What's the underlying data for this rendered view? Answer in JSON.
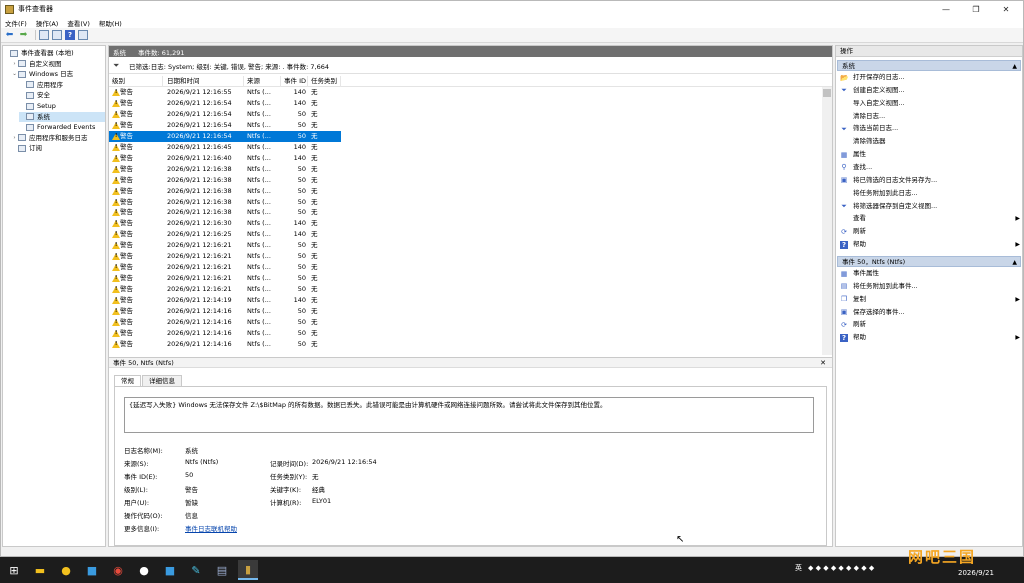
{
  "window": {
    "title": "事件查看器"
  },
  "menu": [
    "文件(F)",
    "操作(A)",
    "查看(V)",
    "帮助(H)"
  ],
  "tree": [
    {
      "label": "事件查看器 (本地)",
      "indent": 0,
      "arrow": ""
    },
    {
      "label": "自定义视图",
      "indent": 1,
      "arrow": "›"
    },
    {
      "label": "Windows 日志",
      "indent": 1,
      "arrow": "⌄"
    },
    {
      "label": "应用程序",
      "indent": 2,
      "arrow": ""
    },
    {
      "label": "安全",
      "indent": 2,
      "arrow": ""
    },
    {
      "label": "Setup",
      "indent": 2,
      "arrow": ""
    },
    {
      "label": "系统",
      "indent": 2,
      "arrow": "",
      "selected": true
    },
    {
      "label": "Forwarded Events",
      "indent": 2,
      "arrow": ""
    },
    {
      "label": "应用程序和服务日志",
      "indent": 1,
      "arrow": "›"
    },
    {
      "label": "订阅",
      "indent": 1,
      "arrow": ""
    }
  ],
  "center": {
    "log_name": "系统",
    "event_count": "事件数: 61,291",
    "filter_text": "已筛选:日志: System; 级别: 关键, 错误, 警告; 来源: . 事件数: 7,664",
    "columns": [
      "级别",
      "日期和时间",
      "来源",
      "事件 ID",
      "任务类别"
    ],
    "rows": [
      [
        "警告",
        "2026/9/21 12:16:55",
        "Ntfs (...",
        "140",
        "无"
      ],
      [
        "警告",
        "2026/9/21 12:16:54",
        "Ntfs (...",
        "140",
        "无"
      ],
      [
        "警告",
        "2026/9/21 12:16:54",
        "Ntfs (...",
        "50",
        "无"
      ],
      [
        "警告",
        "2026/9/21 12:16:54",
        "Ntfs (...",
        "50",
        "无"
      ],
      [
        "警告",
        "2026/9/21 12:16:54",
        "Ntfs (...",
        "50",
        "无"
      ],
      [
        "警告",
        "2026/9/21 12:16:45",
        "Ntfs (...",
        "140",
        "无"
      ],
      [
        "警告",
        "2026/9/21 12:16:40",
        "Ntfs (...",
        "140",
        "无"
      ],
      [
        "警告",
        "2026/9/21 12:16:38",
        "Ntfs (...",
        "50",
        "无"
      ],
      [
        "警告",
        "2026/9/21 12:16:38",
        "Ntfs (...",
        "50",
        "无"
      ],
      [
        "警告",
        "2026/9/21 12:16:38",
        "Ntfs (...",
        "50",
        "无"
      ],
      [
        "警告",
        "2026/9/21 12:16:38",
        "Ntfs (...",
        "50",
        "无"
      ],
      [
        "警告",
        "2026/9/21 12:16:38",
        "Ntfs (...",
        "50",
        "无"
      ],
      [
        "警告",
        "2026/9/21 12:16:30",
        "Ntfs (...",
        "140",
        "无"
      ],
      [
        "警告",
        "2026/9/21 12:16:25",
        "Ntfs (...",
        "140",
        "无"
      ],
      [
        "警告",
        "2026/9/21 12:16:21",
        "Ntfs (...",
        "50",
        "无"
      ],
      [
        "警告",
        "2026/9/21 12:16:21",
        "Ntfs (...",
        "50",
        "无"
      ],
      [
        "警告",
        "2026/9/21 12:16:21",
        "Ntfs (...",
        "50",
        "无"
      ],
      [
        "警告",
        "2026/9/21 12:16:21",
        "Ntfs (...",
        "50",
        "无"
      ],
      [
        "警告",
        "2026/9/21 12:16:21",
        "Ntfs (...",
        "50",
        "无"
      ],
      [
        "警告",
        "2026/9/21 12:14:19",
        "Ntfs (...",
        "140",
        "无"
      ],
      [
        "警告",
        "2026/9/21 12:14:16",
        "Ntfs (...",
        "50",
        "无"
      ],
      [
        "警告",
        "2026/9/21 12:14:16",
        "Ntfs (...",
        "50",
        "无"
      ],
      [
        "警告",
        "2026/9/21 12:14:16",
        "Ntfs (...",
        "50",
        "无"
      ],
      [
        "警告",
        "2026/9/21 12:14:16",
        "Ntfs (...",
        "50",
        "无"
      ]
    ],
    "selected_row": 4
  },
  "detail": {
    "header": "事件 50, Ntfs (Ntfs)",
    "tabs": [
      "常规",
      "详细信息"
    ],
    "message": "{延迟写入失败} Windows 无法保存文件 Z:\\$BitMap 的所有数据。数据已丢失。此错误可能是由计算机硬件或网络连接问题所致。请尝试将此文件保存到其他位置。",
    "fields": {
      "log_name_label": "日志名称(M):",
      "log_name": "系统",
      "source_label": "来源(S):",
      "source": "Ntfs (Ntfs)",
      "recorded_label": "记录时间(D):",
      "recorded": "2026/9/21 12:16:54",
      "event_id_label": "事件 ID(E):",
      "event_id": "50",
      "task_label": "任务类别(Y):",
      "task": "无",
      "level_label": "级别(L):",
      "level": "警告",
      "keywords_label": "关键字(K):",
      "keywords": "经典",
      "user_label": "用户(U):",
      "user": "暂缺",
      "computer_label": "计算机(R):",
      "computer": "ELY01",
      "opcode_label": "操作代码(O):",
      "opcode": "信息",
      "more_label": "更多信息(I):",
      "more_link": "事件日志联机帮助"
    }
  },
  "actions": {
    "title": "操作",
    "section1": "系统",
    "items1": [
      {
        "label": "打开保存的日志...",
        "icon": "folder-icon"
      },
      {
        "label": "创建自定义视图...",
        "icon": "filter-icon"
      },
      {
        "label": "导入自定义视图...",
        "icon": ""
      },
      {
        "label": "清除日志...",
        "icon": ""
      },
      {
        "label": "筛选当前日志...",
        "icon": "filter-icon"
      },
      {
        "label": "清除筛选器",
        "icon": ""
      },
      {
        "label": "属性",
        "icon": "properties-icon"
      },
      {
        "label": "查找...",
        "icon": "binoculars-icon"
      },
      {
        "label": "将已筛选的日志文件另存为...",
        "icon": "save-icon"
      },
      {
        "label": "将任务附加到此日志...",
        "icon": ""
      },
      {
        "label": "将筛选器保存到自定义视图...",
        "icon": "filter-icon"
      },
      {
        "label": "查看",
        "icon": "",
        "sub": true
      },
      {
        "label": "刷新",
        "icon": "refresh-icon"
      },
      {
        "label": "帮助",
        "icon": "help-icon",
        "sub": true
      }
    ],
    "section2": "事件 50，Ntfs (Ntfs)",
    "items2": [
      {
        "label": "事件属性",
        "icon": "properties-icon"
      },
      {
        "label": "将任务附加到此事件...",
        "icon": "task-icon"
      },
      {
        "label": "复制",
        "icon": "copy-icon",
        "sub": true
      },
      {
        "label": "保存选择的事件...",
        "icon": "save-icon"
      },
      {
        "label": "刷新",
        "icon": "refresh-icon"
      },
      {
        "label": "帮助",
        "icon": "help-icon",
        "sub": true
      }
    ]
  },
  "taskbar": {
    "tray_lang": "英",
    "clock_date": "2026/9/21"
  }
}
